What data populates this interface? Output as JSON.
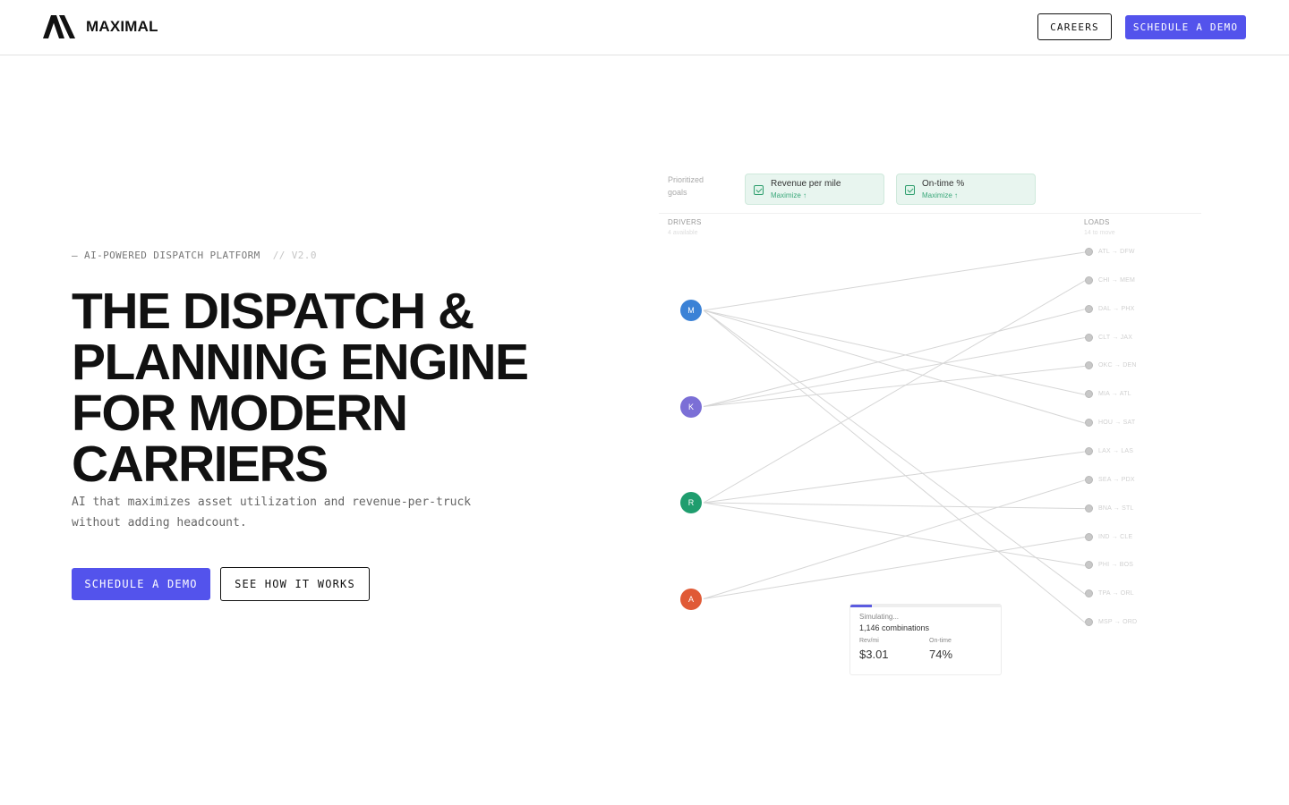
{
  "brand": {
    "name": "MAXIMAL"
  },
  "nav": {
    "careers": "CAREERS",
    "demo": "SCHEDULE A DEMO"
  },
  "hero": {
    "eyebrow": "— AI-POWERED DISPATCH PLATFORM",
    "version": "// V2.0",
    "headline": [
      "THE DISPATCH &",
      "PLANNING ENGINE",
      "FOR MODERN",
      "CARRIERS"
    ],
    "subtitle": [
      "AI that maximizes asset utilization and revenue-per-truck",
      "without adding headcount."
    ],
    "cta_primary": "SCHEDULE A DEMO",
    "cta_secondary": "SEE HOW IT WORKS"
  },
  "visual": {
    "goals_label": [
      "Prioritized",
      "goals"
    ],
    "goals": [
      {
        "title": "Revenue per mile",
        "sub": "Maximize ↑"
      },
      {
        "title": "On-time %",
        "sub": "Maximize ↑"
      }
    ],
    "drivers_label": "DRIVERS",
    "drivers_sub": "4 available",
    "loads_label": "LOADS",
    "loads_sub": "14 to move",
    "drivers": [
      {
        "initial": "M",
        "color": "#3b82d6"
      },
      {
        "initial": "K",
        "color": "#7b6fd6"
      },
      {
        "initial": "R",
        "color": "#1f9d6e"
      },
      {
        "initial": "A",
        "color": "#e05a36"
      }
    ],
    "loads": [
      "ATL → DFW",
      "CHI → MEM",
      "DAL → PHX",
      "CLT → JAX",
      "OKC → DEN",
      "MIA → ATL",
      "HOU → SAT",
      "LAX → LAS",
      "SEA → PDX",
      "BNA → STL",
      "IND → CLE",
      "PHI → BOS",
      "TPA → ORL",
      "MSP → ORD"
    ],
    "edges": [
      [
        0,
        0
      ],
      [
        0,
        5
      ],
      [
        0,
        6
      ],
      [
        0,
        12
      ],
      [
        0,
        13
      ],
      [
        1,
        2
      ],
      [
        1,
        3
      ],
      [
        1,
        4
      ],
      [
        2,
        1
      ],
      [
        2,
        7
      ],
      [
        2,
        9
      ],
      [
        2,
        11
      ],
      [
        3,
        8
      ],
      [
        3,
        10
      ]
    ],
    "sim": {
      "status": "Simulating...",
      "combos": "1,146 combinations",
      "rev_label": "Rev/mi",
      "rev_value": "$3.01",
      "ontime_label": "On-time",
      "ontime_value": "74%",
      "progress": 0.14
    }
  }
}
